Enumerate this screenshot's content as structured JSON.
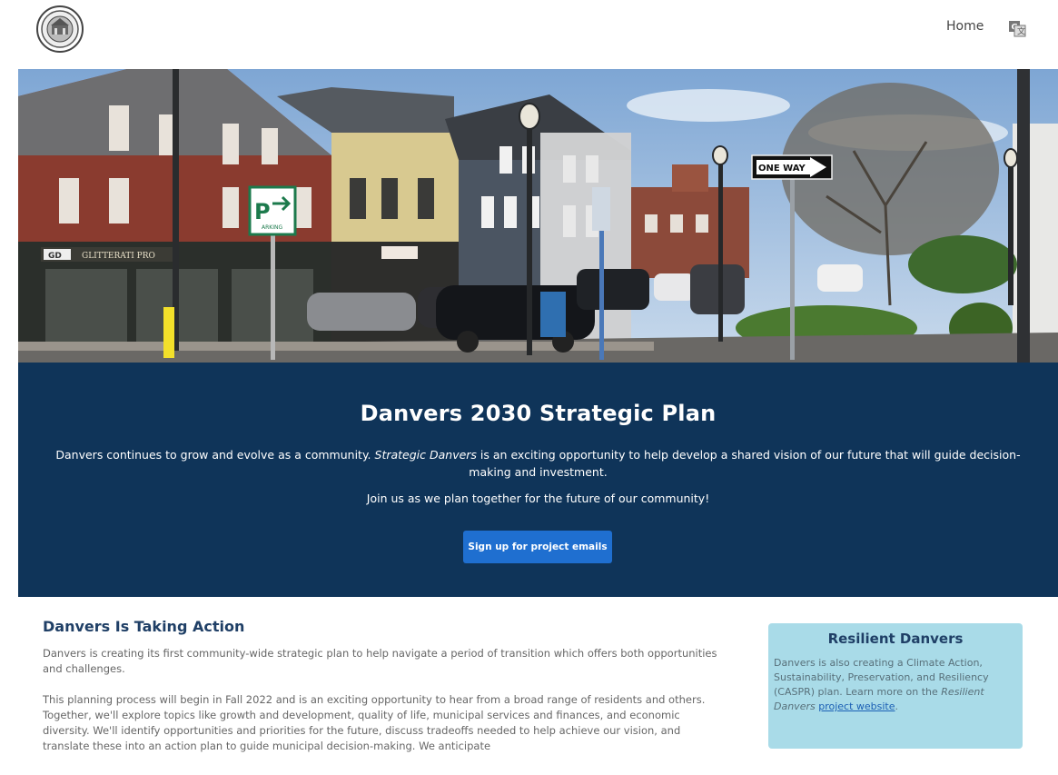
{
  "header": {
    "nav_home": "Home",
    "seal_icon": "town-seal-icon",
    "translate_icon": "translate-icon"
  },
  "hero": {
    "signs": {
      "parking_letter": "P",
      "parking_word": "ARKING",
      "one_way": "ONE WAY",
      "store_logo": "GD",
      "store_name": "GLITTERATI PRO"
    }
  },
  "banner": {
    "title": "Danvers 2030 Strategic Plan",
    "desc_before": "Danvers continues to grow and evolve as a community. ",
    "desc_italic": "Strategic Danvers",
    "desc_after": " is an exciting opportunity to help develop a shared vision of our future that will guide decision-making and investment.",
    "join": "Join us as we plan together for the future of our community!",
    "button": "Sign up for project emails"
  },
  "action": {
    "title": "Danvers Is Taking Action",
    "p1": "Danvers is creating its first community-wide strategic plan to help navigate a period of transition which offers both opportunities and challenges.",
    "p2": "This planning process will begin in Fall 2022 and is an exciting opportunity to hear from a broad range of residents and others. Together, we'll explore topics like growth and development, quality of life, municipal services and finances, and economic diversity. We'll identify opportunities and priorities for the future, discuss tradeoffs needed to help achieve our vision, and translate these into an action plan to guide municipal decision-making. We anticipate"
  },
  "resilient": {
    "title": "Resilient Danvers",
    "text_before": "Danvers is also creating a Climate Action, Sustainability, Preservation, and Resiliency (CASPR) plan. Learn more on the ",
    "text_italic": "Resilient Danvers",
    "text_space": " ",
    "link": "project website",
    "text_after": "."
  },
  "colors": {
    "banner_bg": "#0f3459",
    "button_bg": "#1f6fd0",
    "heading": "#1f3f66",
    "callout_bg": "#a9dbe8"
  }
}
